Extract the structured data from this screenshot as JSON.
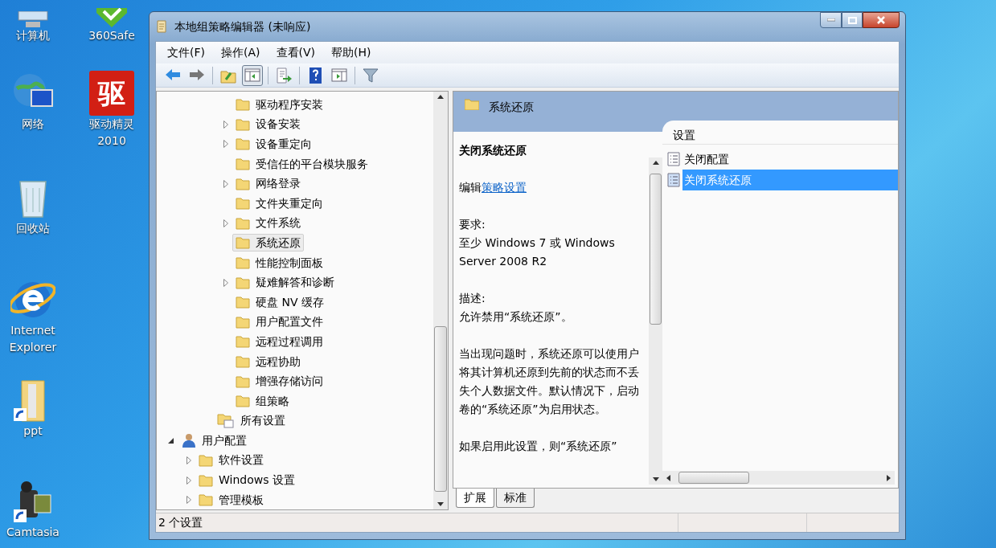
{
  "desktop_icons": [
    {
      "kind": "computer",
      "label": "计算机"
    },
    {
      "kind": "network",
      "label": "网络"
    },
    {
      "kind": "recycle",
      "label": "回收站"
    },
    {
      "kind": "browser",
      "label": "Internet\nExplorer"
    },
    {
      "kind": "folder",
      "label": "ppt"
    },
    {
      "kind": "camera",
      "label": "Camtasia"
    },
    {
      "kind": "shield",
      "label": "360Safe"
    },
    {
      "kind": "driver",
      "label": "驱动精灵\n2010",
      "glyph": "驱"
    }
  ],
  "window": {
    "title": "本地组策略编辑器 (未响应)"
  },
  "menu": [
    "文件(F)",
    "操作(A)",
    "查看(V)",
    "帮助(H)"
  ],
  "toolbar": [
    {
      "kind": "back",
      "pressed": false
    },
    {
      "kind": "forward",
      "pressed": false
    },
    {
      "kind": "sep"
    },
    {
      "kind": "up",
      "pressed": false
    },
    {
      "kind": "tree",
      "pressed": true
    },
    {
      "kind": "sep"
    },
    {
      "kind": "export",
      "pressed": false
    },
    {
      "kind": "sep"
    },
    {
      "kind": "help",
      "pressed": false
    },
    {
      "kind": "pane",
      "pressed": false
    },
    {
      "kind": "sep"
    },
    {
      "kind": "filter",
      "pressed": false
    }
  ],
  "tree": {
    "continued": [
      {
        "children": [
          {
            "label": "驱动程序安装",
            "expandable": false,
            "selected": false,
            "kind": "folder"
          },
          {
            "label": "设备安装",
            "expandable": true,
            "selected": false,
            "kind": "folder"
          },
          {
            "label": "设备重定向",
            "expandable": true,
            "selected": false,
            "kind": "folder"
          },
          {
            "label": "受信任的平台模块服务",
            "expandable": false,
            "selected": false,
            "kind": "folder"
          },
          {
            "label": "网络登录",
            "expandable": true,
            "selected": false,
            "kind": "folder"
          },
          {
            "label": "文件夹重定向",
            "expandable": false,
            "selected": false,
            "kind": "folder"
          },
          {
            "label": "文件系统",
            "expandable": true,
            "selected": false,
            "kind": "folder"
          },
          {
            "label": "系统还原",
            "expandable": false,
            "selected": true,
            "kind": "folder"
          },
          {
            "label": "性能控制面板",
            "expandable": false,
            "selected": false,
            "kind": "folder"
          },
          {
            "label": "疑难解答和诊断",
            "expandable": true,
            "selected": false,
            "kind": "folder"
          },
          {
            "label": "硬盘 NV 缓存",
            "expandable": false,
            "selected": false,
            "kind": "folder"
          },
          {
            "label": "用户配置文件",
            "expandable": false,
            "selected": false,
            "kind": "folder"
          },
          {
            "label": "远程过程调用",
            "expandable": false,
            "selected": false,
            "kind": "folder"
          },
          {
            "label": "远程协助",
            "expandable": false,
            "selected": false,
            "kind": "folder"
          },
          {
            "label": "增强存储访问",
            "expandable": false,
            "selected": false,
            "kind": "folder"
          },
          {
            "label": "组策略",
            "expandable": false,
            "selected": false,
            "kind": "folder"
          }
        ]
      },
      {
        "label": "所有设置",
        "expandable": false,
        "selected": false,
        "kind": "settings"
      }
    ],
    "roots": [
      {
        "label": "用户配置",
        "expandable": true,
        "expanded": true,
        "selected": false,
        "kind": "user",
        "children": [
          {
            "label": "软件设置",
            "expandable": true,
            "selected": false,
            "kind": "folder"
          },
          {
            "label": "Windows 设置",
            "expandable": true,
            "selected": false,
            "kind": "folder"
          },
          {
            "label": "管理模板",
            "expandable": true,
            "selected": false,
            "kind": "folder"
          }
        ]
      }
    ]
  },
  "detail": {
    "header": "系统还原",
    "setting_title": "关闭系统还原",
    "edit_prefix": "编辑",
    "edit_link": "策略设置",
    "requirements_label": "要求:",
    "requirements": "至少 Windows 7 或 Windows Server 2008 R2",
    "description_label": "描述:",
    "description": [
      "允许禁用“系统还原”。",
      "当出现问题时，系统还原可以使用户将其计算机还原到先前的状态而不丢失个人数据文件。默认情况下，启动卷的“系统还原”为启用状态。",
      "如果启用此设置，则“系统还原”"
    ]
  },
  "settings_list": {
    "column": "设置",
    "items": [
      {
        "label": "关闭配置",
        "selected": false
      },
      {
        "label": "关闭系统还原",
        "selected": true
      }
    ]
  },
  "tabs": [
    {
      "label": "扩展",
      "selected": true
    },
    {
      "label": "标准",
      "selected": false
    }
  ],
  "status_bar": "2 个设置"
}
